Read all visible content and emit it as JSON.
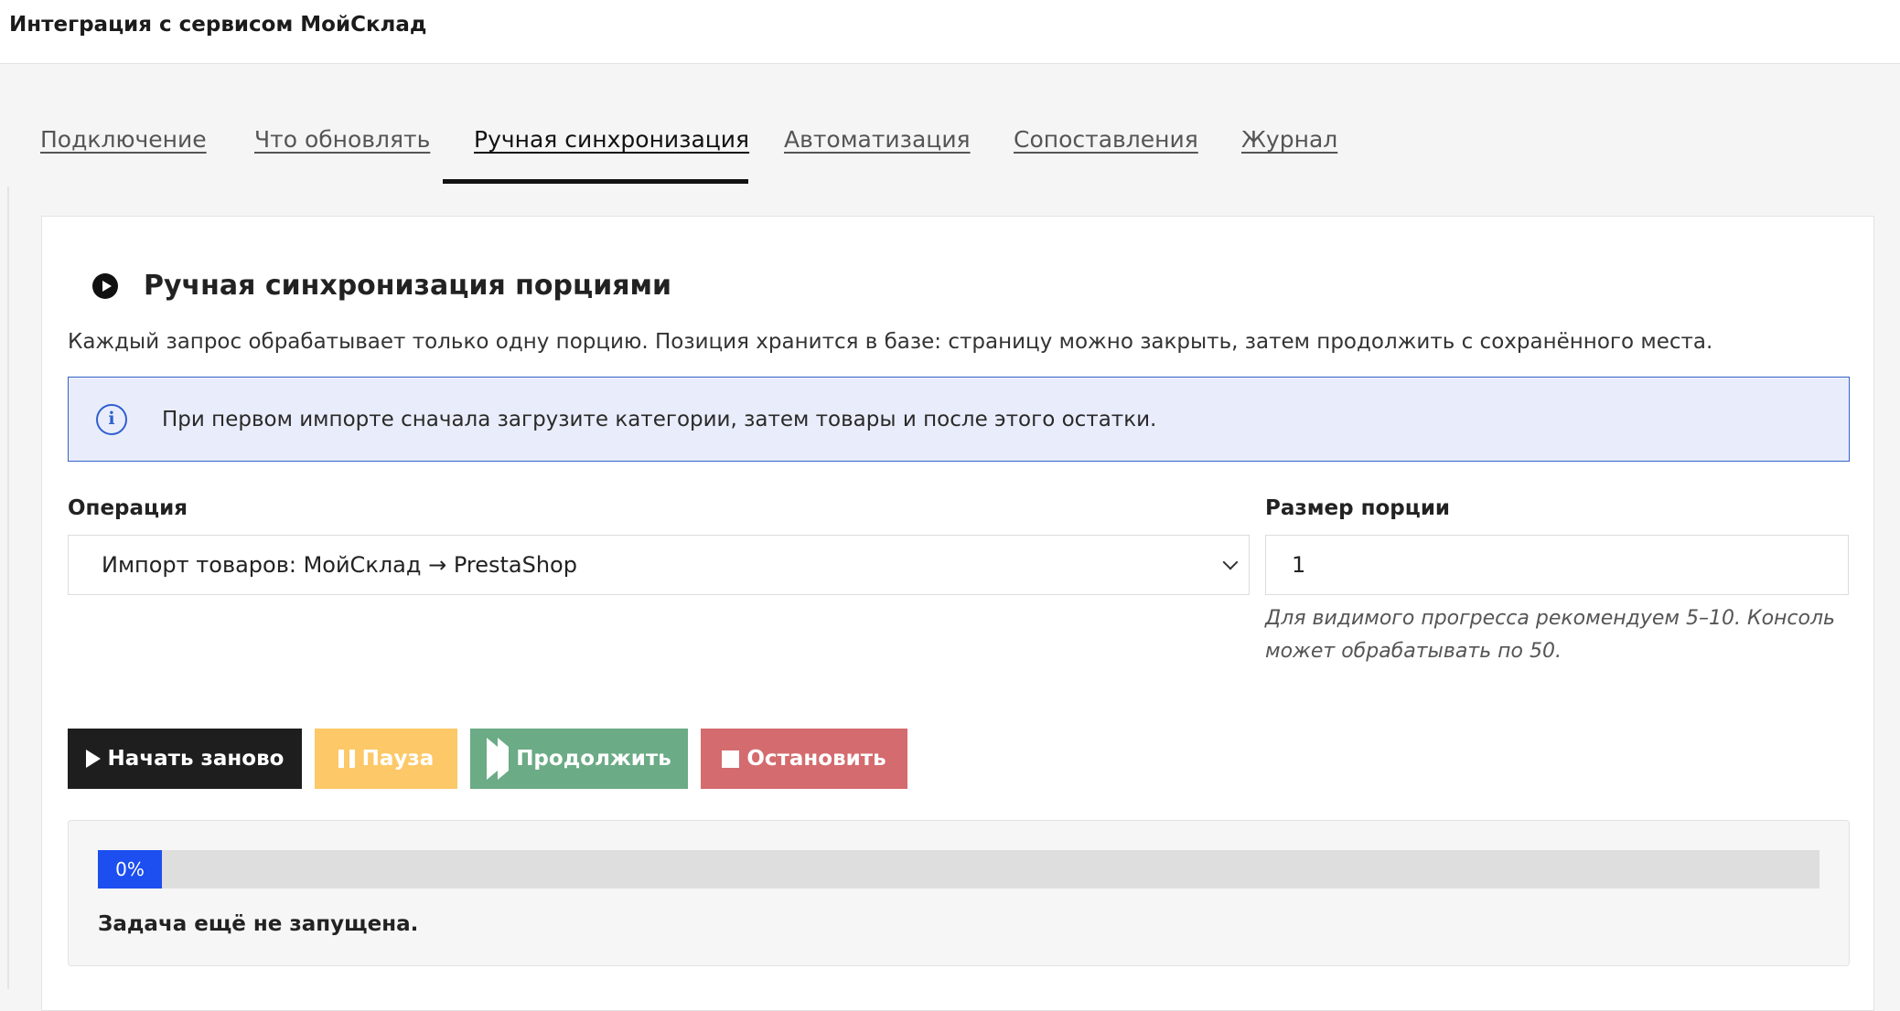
{
  "header": {
    "title": "Интеграция с сервисом МойСклад"
  },
  "tabs": [
    {
      "label": "Подключение",
      "active": false
    },
    {
      "label": "Что обновлять",
      "active": false
    },
    {
      "label": "Ручная синхронизация",
      "active": true
    },
    {
      "label": "Автоматизация",
      "active": false
    },
    {
      "label": "Сопоставления",
      "active": false
    },
    {
      "label": "Журнал",
      "active": false
    }
  ],
  "panel": {
    "icon": "play-circle-icon",
    "title": "Ручная синхронизация порциями",
    "description": "Каждый запрос обрабатывает только одну порцию. Позиция хранится в базе: страницу можно закрыть, затем продолжить с сохранённого места.",
    "info": {
      "icon": "info-icon",
      "text": "При первом импорте сначала загрузите категории, затем товары и после этого остатки."
    },
    "operation": {
      "label": "Операция",
      "selected": "Импорт товаров: МойСклад → PrestaShop"
    },
    "batch_size": {
      "label": "Размер порции",
      "value": "1",
      "hint": "Для видимого прогресса рекомендуем 5–10. Консоль может обрабатывать по 50."
    },
    "buttons": {
      "start": "Начать заново",
      "pause": "Пауза",
      "continue": "Продолжить",
      "stop": "Остановить"
    },
    "progress": {
      "percent": 0,
      "percent_label": "0%",
      "status": "Задача ещё не запущена."
    }
  },
  "colors": {
    "accent_blue": "#1c4ef0",
    "start_button": "#1e1e1e",
    "pause_button": "#fdc867",
    "continue_button": "#6bab85",
    "stop_button": "#d46b6e",
    "info_background": "#e9edfb",
    "info_border": "#3463c4"
  }
}
